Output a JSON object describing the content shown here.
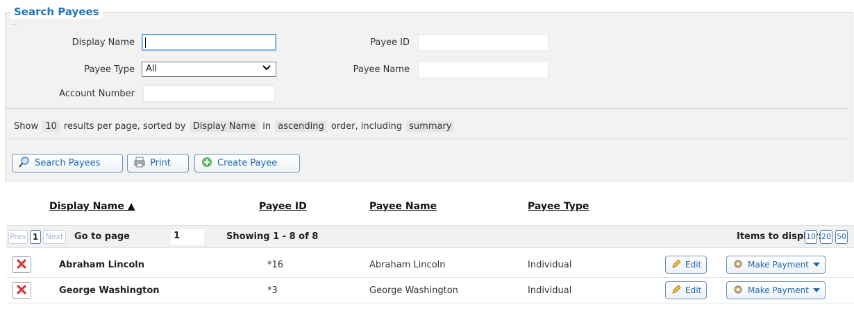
{
  "search": {
    "legend": "Search Payees",
    "fields": {
      "display_name": {
        "label": "Display Name",
        "value": ""
      },
      "payee_id": {
        "label": "Payee ID",
        "value": ""
      },
      "payee_type": {
        "label": "Payee Type",
        "value": "All"
      },
      "payee_name": {
        "label": "Payee Name",
        "value": ""
      },
      "account_number": {
        "label": "Account Number",
        "value": ""
      }
    },
    "sort": {
      "show": "Show",
      "count": "10",
      "results_per_page": "results per page, sorted by",
      "sort_field": "Display Name",
      "in": "in",
      "order": "ascending",
      "order_including": "order, including",
      "include": "summary"
    },
    "buttons": {
      "search": "Search Payees",
      "print": "Print",
      "create": "Create Payee"
    }
  },
  "table": {
    "headers": {
      "display_name": "Display Name ▲",
      "payee_id": "Payee ID",
      "payee_name": "Payee Name",
      "payee_type": "Payee Type"
    },
    "pager": {
      "prev": "Prev",
      "page": "1",
      "next": "Next",
      "goto_label": "Go to page",
      "goto_value": "1",
      "showing": "Showing 1 - 8 of 8",
      "items_label": "Items to display:",
      "items_options": [
        "10",
        "20",
        "50"
      ]
    },
    "rows": [
      {
        "display_name": "Abraham Lincoln",
        "payee_id": "*16",
        "payee_name": "Abraham Lincoln",
        "payee_type": "Individual",
        "edit": "Edit",
        "make_payment": "Make Payment"
      },
      {
        "display_name": "George Washington",
        "payee_id": "*3",
        "payee_name": "George Washington",
        "payee_type": "Individual",
        "edit": "Edit",
        "make_payment": "Make Payment"
      }
    ]
  },
  "colors": {
    "accent": "#1f73b7",
    "delete": "#d9383a"
  }
}
